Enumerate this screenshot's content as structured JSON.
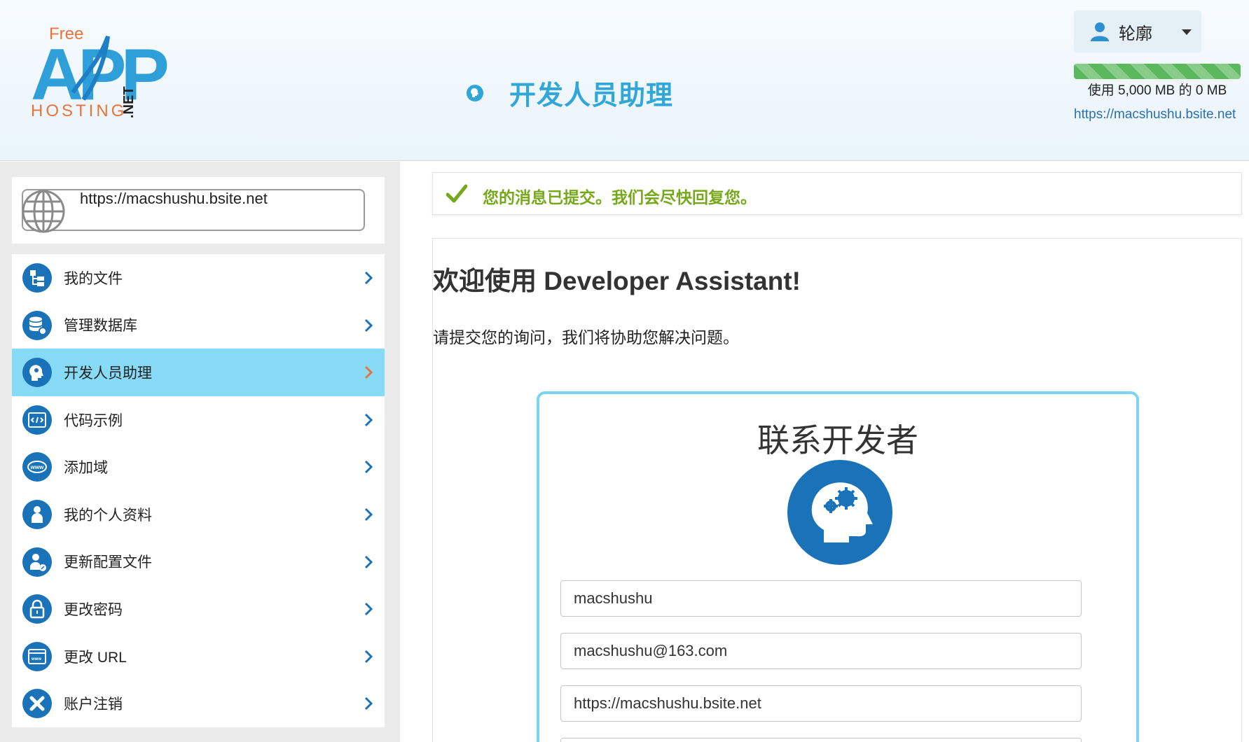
{
  "header": {
    "logo_top": "Free",
    "logo_main": "APP",
    "logo_bottom": "HOSTING",
    "logo_suffix": ".NET",
    "page_title": "开发人员助理",
    "profile_label": "轮廓",
    "usage_text": "使用 5,000 MB 的 0 MB",
    "usage_fraction": 1.0,
    "site_url": "https://macshushu.bsite.net"
  },
  "sidebar": {
    "url_value": "https://macshushu.bsite.net",
    "items": [
      {
        "label": "我的文件",
        "icon": "files-icon",
        "active": false
      },
      {
        "label": "管理数据库",
        "icon": "database-icon",
        "active": false
      },
      {
        "label": "开发人员助理",
        "icon": "developer-head-icon",
        "active": true
      },
      {
        "label": "代码示例",
        "icon": "code-icon",
        "active": false
      },
      {
        "label": "添加域",
        "icon": "www-icon",
        "active": false
      },
      {
        "label": "我的个人资料",
        "icon": "person-icon",
        "active": false
      },
      {
        "label": "更新配置文件",
        "icon": "edit-profile-icon",
        "active": false
      },
      {
        "label": "更改密码",
        "icon": "lock-icon",
        "active": false
      },
      {
        "label": "更改 URL",
        "icon": "url-icon",
        "active": false
      },
      {
        "label": "账户注销",
        "icon": "close-icon",
        "active": false
      }
    ]
  },
  "alert": {
    "message": "您的消息已提交。我们会尽快回复您。"
  },
  "main": {
    "welcome": "欢迎使用 Developer Assistant!",
    "subtext": "请提交您的询问，我们将协助您解决问题。",
    "contact_title": "联系开发者",
    "fields": {
      "name": "macshushu",
      "email": "macshushu@163.com",
      "url": "https://macshushu.bsite.net"
    }
  },
  "colors": {
    "accent": "#31a6d8",
    "icon_blue": "#1a73b8",
    "active_bg": "#87dbf7",
    "success": "#76a81c",
    "card_border": "#7cd3f3"
  }
}
